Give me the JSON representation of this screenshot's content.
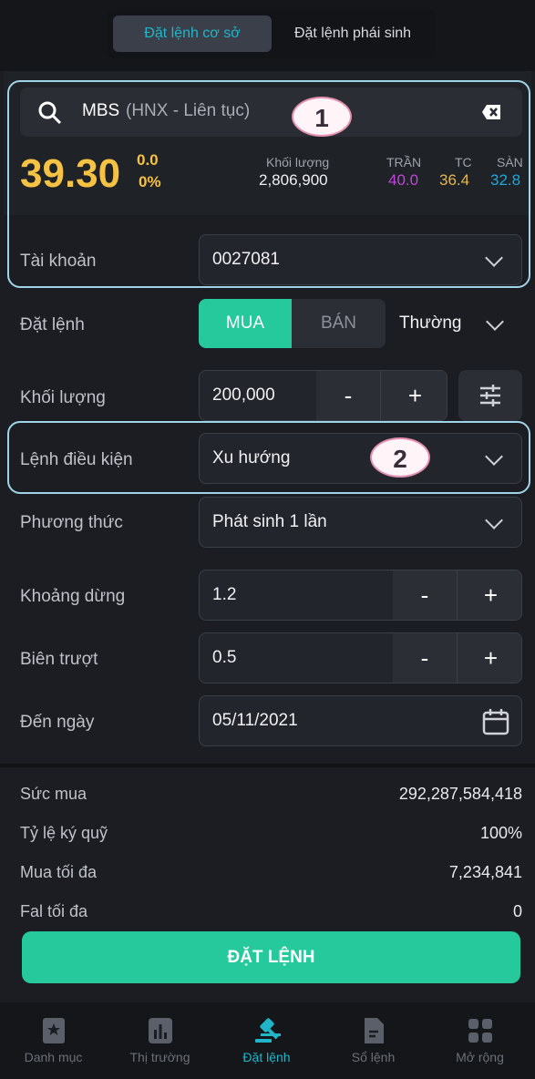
{
  "tabs": {
    "active": "Đặt lệnh cơ sở",
    "inactive": "Đặt lệnh phái sinh"
  },
  "search": {
    "symbol": "MBS",
    "exchange": "(HNX - Liên tục)"
  },
  "quote": {
    "price": "39.30",
    "change": "0.0",
    "change_pct": "0%",
    "volume_label": "Khối lượng",
    "volume": "2,806,900",
    "ceiling_label": "TRẦN",
    "ceiling": "40.0",
    "ref_label": "TC",
    "ref": "36.4",
    "floor_label": "SÀN",
    "floor": "32.8",
    "colors": {
      "price": "#f5c243",
      "ceiling": "#c045d9",
      "ref": "#e8b84a",
      "floor": "#1aa9e0"
    }
  },
  "account": {
    "label": "Tài khoản",
    "value": "0027081"
  },
  "order_type": {
    "label": "Đặt lệnh",
    "buy": "MUA",
    "sell": "BÁN",
    "kind": "Thường"
  },
  "quantity": {
    "label": "Khối lượng",
    "value": "200,000",
    "minus": "-",
    "plus": "+"
  },
  "condition": {
    "label": "Lệnh điều kiện",
    "value": "Xu hướng"
  },
  "method": {
    "label": "Phương thức",
    "value": "Phát sinh 1 lần"
  },
  "stop": {
    "label": "Khoảng dừng",
    "value": "1.2",
    "minus": "-",
    "plus": "+"
  },
  "slip": {
    "label": "Biên trượt",
    "value": "0.5",
    "minus": "-",
    "plus": "+"
  },
  "date": {
    "label": "Đến ngày",
    "value": "05/11/2021"
  },
  "summary": {
    "buying_power_label": "Sức mua",
    "buying_power": "292,287,584,418",
    "margin_label": "Tỷ lệ ký quỹ",
    "margin": "100%",
    "max_buy_label": "Mua tối đa",
    "max_buy": "7,234,841",
    "fal_label": "Fal tối đa",
    "fal": "0"
  },
  "submit": "ĐẶT LỆNH",
  "annotations": {
    "one": "1",
    "two": "2"
  },
  "nav": [
    "Danh mục",
    "Thị trường",
    "Đặt lệnh",
    "Sổ lệnh",
    "Mở rộng"
  ],
  "accent": "#25c99b"
}
